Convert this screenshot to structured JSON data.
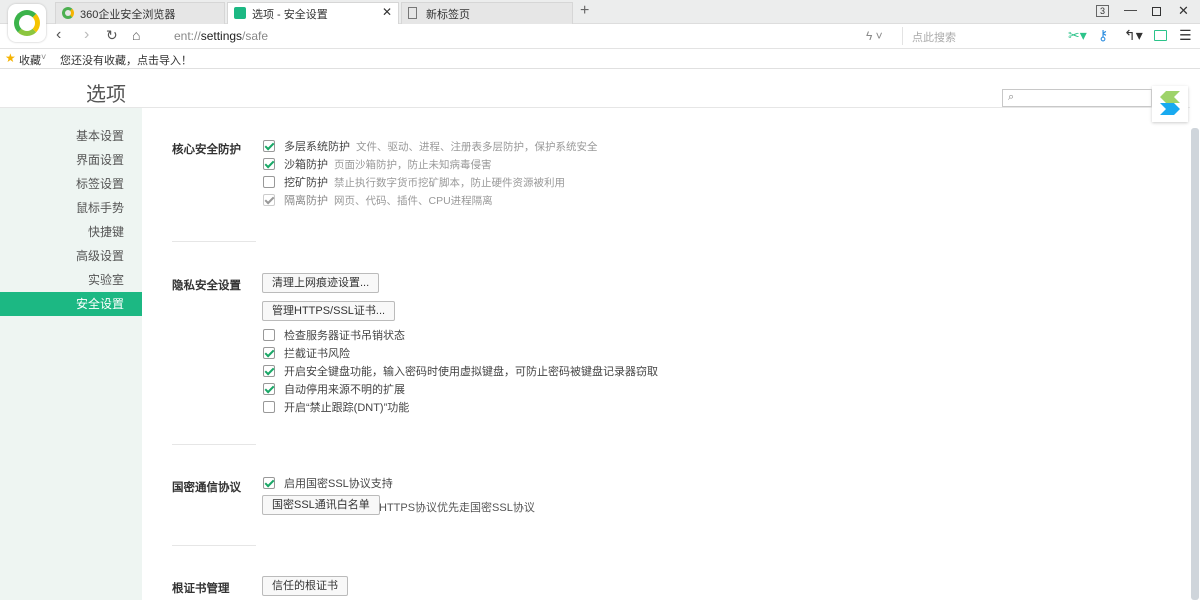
{
  "tabs": [
    {
      "label": "360企业安全浏览器"
    },
    {
      "label": "选项 - 安全设置"
    },
    {
      "label": "新标签页"
    }
  ],
  "window": {
    "tab_count": "3"
  },
  "address": {
    "url_prefix": "ent://",
    "url_host": "settings",
    "url_path": "/safe",
    "search_placeholder": "点此搜索"
  },
  "bookmarks": {
    "label": "收藏",
    "empty_hint": "您还没有收藏，点击导入！"
  },
  "page": {
    "title": "选项"
  },
  "sidebar": {
    "items": [
      {
        "label": "基本设置"
      },
      {
        "label": "界面设置"
      },
      {
        "label": "标签设置"
      },
      {
        "label": "鼠标手势"
      },
      {
        "label": "快捷键"
      },
      {
        "label": "高级设置"
      },
      {
        "label": "实验室"
      },
      {
        "label": "安全设置"
      }
    ]
  },
  "core": {
    "label": "核心安全防护",
    "items": [
      {
        "label": "多层系统防护",
        "desc": "文件、驱动、进程、注册表多层防护，保护系统安全",
        "checked": true
      },
      {
        "label": "沙箱防护",
        "desc": "页面沙箱防护，防止未知病毒侵害",
        "checked": true
      },
      {
        "label": "挖矿防护",
        "desc": "禁止执行数字货币挖矿脚本，防止硬件资源被利用",
        "checked": false
      },
      {
        "label": "隔离防护",
        "desc": "网页、代码、插件、CPU进程隔离",
        "checked": true
      }
    ]
  },
  "privacy": {
    "label": "隐私安全设置",
    "clear_button": "清理上网痕迹设置...",
    "https_button": "管理HTTPS/SSL证书...",
    "items": [
      {
        "label": "检查服务器证书吊销状态",
        "checked": false
      },
      {
        "label": "拦截证书风险",
        "checked": true
      },
      {
        "label": "开启安全键盘功能，输入密码时使用虚拟键盘，可防止密码被键盘记录器窃取",
        "checked": true
      },
      {
        "label": "自动停用来源不明的扩展",
        "checked": true
      },
      {
        "label": "开启“禁止跟踪(DNT)”功能",
        "checked": false
      }
    ]
  },
  "gm": {
    "label": "国密通信协议",
    "item": "启用国密SSL协议支持",
    "whitelist_button": "国密SSL通讯白名单",
    "note": "HTTPS协议优先走国密SSL协议"
  },
  "root": {
    "label": "根证书管理",
    "button": "信任的根证书"
  },
  "colors": {
    "accent": "#1cb883",
    "check": "#1aa867"
  }
}
